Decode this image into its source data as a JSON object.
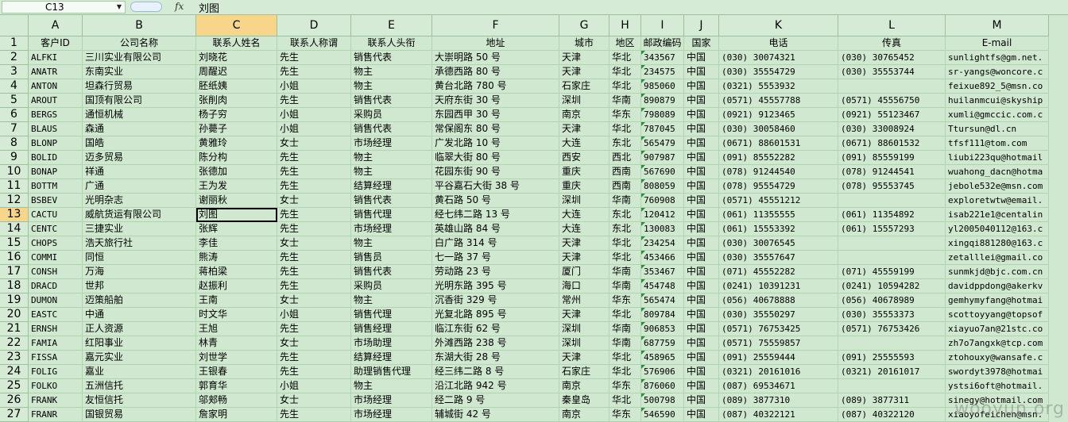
{
  "formula_bar": {
    "name_box": "C13",
    "fx_label": "fx",
    "content": "刘图"
  },
  "columns": [
    "",
    "A",
    "B",
    "C",
    "D",
    "E",
    "F",
    "G",
    "H",
    "I",
    "J",
    "K",
    "L",
    "M"
  ],
  "headers": [
    "客户ID",
    "公司名称",
    "联系人姓名",
    "联系人称谓",
    "联系人头衔",
    "地址",
    "城市",
    "地区",
    "邮政编码",
    "国家",
    "电话",
    "传真",
    "E-mail"
  ],
  "rows": [
    [
      "2",
      "ALFKI",
      "三川实业有限公司",
      "刘晓花",
      "先生",
      "销售代表",
      "大崇明路 50 号",
      "天津",
      "华北",
      "343567",
      "中国",
      "(030) 30074321",
      "(030) 30765452",
      "sunlightfs@gm.net."
    ],
    [
      "3",
      "ANATR",
      "东南实业",
      "周醒迟",
      "先生",
      "物主",
      "承德西路 80 号",
      "天津",
      "华北",
      "234575",
      "中国",
      "(030) 35554729",
      "(030) 35553744",
      "sr-yangs@woncore.c"
    ],
    [
      "4",
      "ANTON",
      "坦森行贸易",
      "胚纸姨",
      "小姐",
      "物主",
      "黄台北路 780 号",
      "石家庄",
      "华北",
      "985060",
      "中国",
      "(0321) 5553932",
      "",
      "feixue892_5@msn.co"
    ],
    [
      "5",
      "AROUT",
      "国顶有限公司",
      "张削肉",
      "先生",
      "销售代表",
      "天府东街 30 号",
      "深圳",
      "华南",
      "890879",
      "中国",
      "(0571) 45557788",
      "(0571) 45556750",
      "huilanmcui@skyship"
    ],
    [
      "6",
      "BERGS",
      "通恒机械",
      "杨子穷",
      "小姐",
      "采购员",
      "东园西甲 30 号",
      "南京",
      "华东",
      "798089",
      "中国",
      "(0921) 9123465",
      "(0921) 55123467",
      "xumli@gmccic.com.c"
    ],
    [
      "7",
      "BLAUS",
      "森通",
      "孙薨子",
      "小姐",
      "销售代表",
      "常保阁东 80 号",
      "天津",
      "华北",
      "787045",
      "中国",
      "(030) 30058460",
      "(030) 33008924",
      "Ttursun@dl.cn"
    ],
    [
      "8",
      "BLONP",
      "国皓",
      "黄雅玲",
      "女士",
      "市场经理",
      "广发北路 10 号",
      "大连",
      "东北",
      "565479",
      "中国",
      "(0671) 88601531",
      "(0671) 88601532",
      "tfsf111@tom.com"
    ],
    [
      "9",
      "BOLID",
      "迈多贸易",
      "陈分构",
      "先生",
      "物主",
      "临翠大街 80 号",
      "西安",
      "西北",
      "907987",
      "中国",
      "(091) 85552282",
      "(091) 85559199",
      "liubi223qu@hotmail"
    ],
    [
      "10",
      "BONAP",
      "祥通",
      "张德加",
      "先生",
      "物主",
      "花园东街 90 号",
      "重庆",
      "西南",
      "567690",
      "中国",
      "(078) 91244540",
      "(078) 91244541",
      "wuahong_dacn@hotma"
    ],
    [
      "11",
      "BOTTM",
      "广通",
      "王为发",
      "先生",
      "结算经理",
      "平谷嘉石大街 38 号",
      "重庆",
      "西南",
      "808059",
      "中国",
      "(078) 95554729",
      "(078) 95553745",
      "jebole532e@msn.com"
    ],
    [
      "12",
      "BSBEV",
      "光明杂志",
      "谢丽秋",
      "女士",
      "销售代表",
      "黄石路 50 号",
      "深圳",
      "华南",
      "760908",
      "中国",
      "(0571) 45551212",
      "",
      "exploretwtw@email."
    ],
    [
      "13",
      "CACTU",
      "威航货运有限公司",
      "刘图",
      "先生",
      "销售代理",
      "经七纬二路 13 号",
      "大连",
      "东北",
      "120412",
      "中国",
      "(061) 11355555",
      "(061) 11354892",
      "isab221e1@centalin"
    ],
    [
      "14",
      "CENTC",
      "三捷实业",
      "张辉",
      "先生",
      "市场经理",
      "英雄山路 84 号",
      "大连",
      "东北",
      "130083",
      "中国",
      "(061) 15553392",
      "(061) 15557293",
      "yl2005040112@163.c"
    ],
    [
      "15",
      "CHOPS",
      "浩天旅行社",
      "李佳",
      "女士",
      "物主",
      "白广路 314 号",
      "天津",
      "华北",
      "234254",
      "中国",
      "(030) 30076545",
      "",
      "xingqi881280@163.c"
    ],
    [
      "16",
      "COMMI",
      "同恒",
      "熊涛",
      "先生",
      "销售员",
      "七一路 37 号",
      "天津",
      "华北",
      "453466",
      "中国",
      "(030) 35557647",
      "",
      "zetalllei@gmail.co"
    ],
    [
      "17",
      "CONSH",
      "万海",
      "蒋柏梁",
      "先生",
      "销售代表",
      "劳动路 23 号",
      "厦门",
      "华南",
      "353467",
      "中国",
      "(071) 45552282",
      "(071) 45559199",
      "sunmkjd@bjc.com.cn"
    ],
    [
      "18",
      "DRACD",
      "世邦",
      "赵振利",
      "先生",
      "采购员",
      "光明东路 395 号",
      "海口",
      "华南",
      "454748",
      "中国",
      "(0241) 10391231",
      "(0241) 10594282",
      "davidppdong@akerkv"
    ],
    [
      "19",
      "DUMON",
      "迈策船舶",
      "王南",
      "女士",
      "物主",
      "沉香街 329 号",
      "常州",
      "华东",
      "565474",
      "中国",
      "(056) 40678888",
      "(056) 40678989",
      "gemhymyfang@hotmai"
    ],
    [
      "20",
      "EASTC",
      "中通",
      "时文华",
      "小姐",
      "销售代理",
      "光复北路 895 号",
      "天津",
      "华北",
      "809784",
      "中国",
      "(030) 35550297",
      "(030) 35553373",
      "scottoyyang@topsof"
    ],
    [
      "21",
      "ERNSH",
      "正人资源",
      "王旭",
      "先生",
      "销售经理",
      "临江东街 62 号",
      "深圳",
      "华南",
      "906853",
      "中国",
      "(0571) 76753425",
      "(0571) 76753426",
      "xiayuo7an@21stc.co"
    ],
    [
      "22",
      "FAMIA",
      "红阳事业",
      "林青",
      "女士",
      "市场助理",
      "外滩西路 238 号",
      "深圳",
      "华南",
      "687759",
      "中国",
      "(0571) 75559857",
      "",
      "zh7o7angxk@tcp.com"
    ],
    [
      "23",
      "FISSA",
      "嘉元实业",
      "刘世学",
      "先生",
      "结算经理",
      "东湖大街 28 号",
      "天津",
      "华北",
      "458965",
      "中国",
      "(091) 25559444",
      "(091) 25555593",
      "ztohouxy@wansafe.c"
    ],
    [
      "24",
      "FOLIG",
      "嘉业",
      "王银春",
      "先生",
      "助理销售代理",
      "经三纬二路 8 号",
      "石家庄",
      "华北",
      "576906",
      "中国",
      "(0321) 20161016",
      "(0321) 20161017",
      "swordyt3978@hotmai"
    ],
    [
      "25",
      "FOLKO",
      "五洲信托",
      "郭育华",
      "小姐",
      "物主",
      "沿江北路 942 号",
      "南京",
      "华东",
      "876060",
      "中国",
      "(087) 69534671",
      "",
      "ystsi6oft@hotmail."
    ],
    [
      "26",
      "FRANK",
      "友恒信托",
      "邬郏畅",
      "女士",
      "市场经理",
      "经二路 9 号",
      "秦皇岛",
      "华北",
      "500798",
      "中国",
      "(089) 3877310",
      "(089) 3877311",
      "sinegy@hotmail.com"
    ],
    [
      "27",
      "FRANR",
      "国银贸易",
      "詹家明",
      "先生",
      "市场经理",
      "辅城街 42 号",
      "南京",
      "华东",
      "546590",
      "中国",
      "(087) 40322121",
      "(087) 40322120",
      "xiaoyofeichen@msn."
    ]
  ],
  "selected_row": "13",
  "selected_col": "C",
  "watermark": "wooyun.org"
}
